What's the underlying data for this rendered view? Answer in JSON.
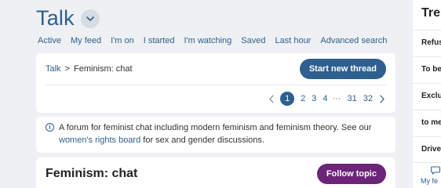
{
  "header": {
    "title": "Talk"
  },
  "nav": [
    {
      "label": "Active"
    },
    {
      "label": "My feed"
    },
    {
      "label": "I'm on"
    },
    {
      "label": "I started"
    },
    {
      "label": "I'm watching"
    },
    {
      "label": "Saved"
    },
    {
      "label": "Last hour"
    },
    {
      "label": "Advanced search"
    }
  ],
  "breadcrumb": {
    "root": "Talk",
    "separator": ">",
    "current": "Feminism: chat"
  },
  "actions": {
    "start_thread": "Start new thread",
    "follow_topic": "Follow topic"
  },
  "pagination": {
    "pages": [
      "1",
      "2",
      "3",
      "4"
    ],
    "current": "1",
    "ellipsis": "···",
    "last_pages": [
      "31",
      "32"
    ]
  },
  "info": {
    "text_before": "A forum for feminist chat including modern feminism and feminism theory. See our ",
    "link": "women's rights board",
    "text_after": " for sex and gender discussions.",
    "icon": "info-icon"
  },
  "topic": {
    "title": "Feminism: chat"
  },
  "sidebar": {
    "title": "Tre",
    "items": [
      "Refus",
      "To be",
      "Exclu",
      "to me",
      "Drive"
    ],
    "feed_label": "My fe"
  },
  "colors": {
    "accent": "#2e5f8e",
    "follow": "#6b2478",
    "background": "#eef0f3"
  }
}
